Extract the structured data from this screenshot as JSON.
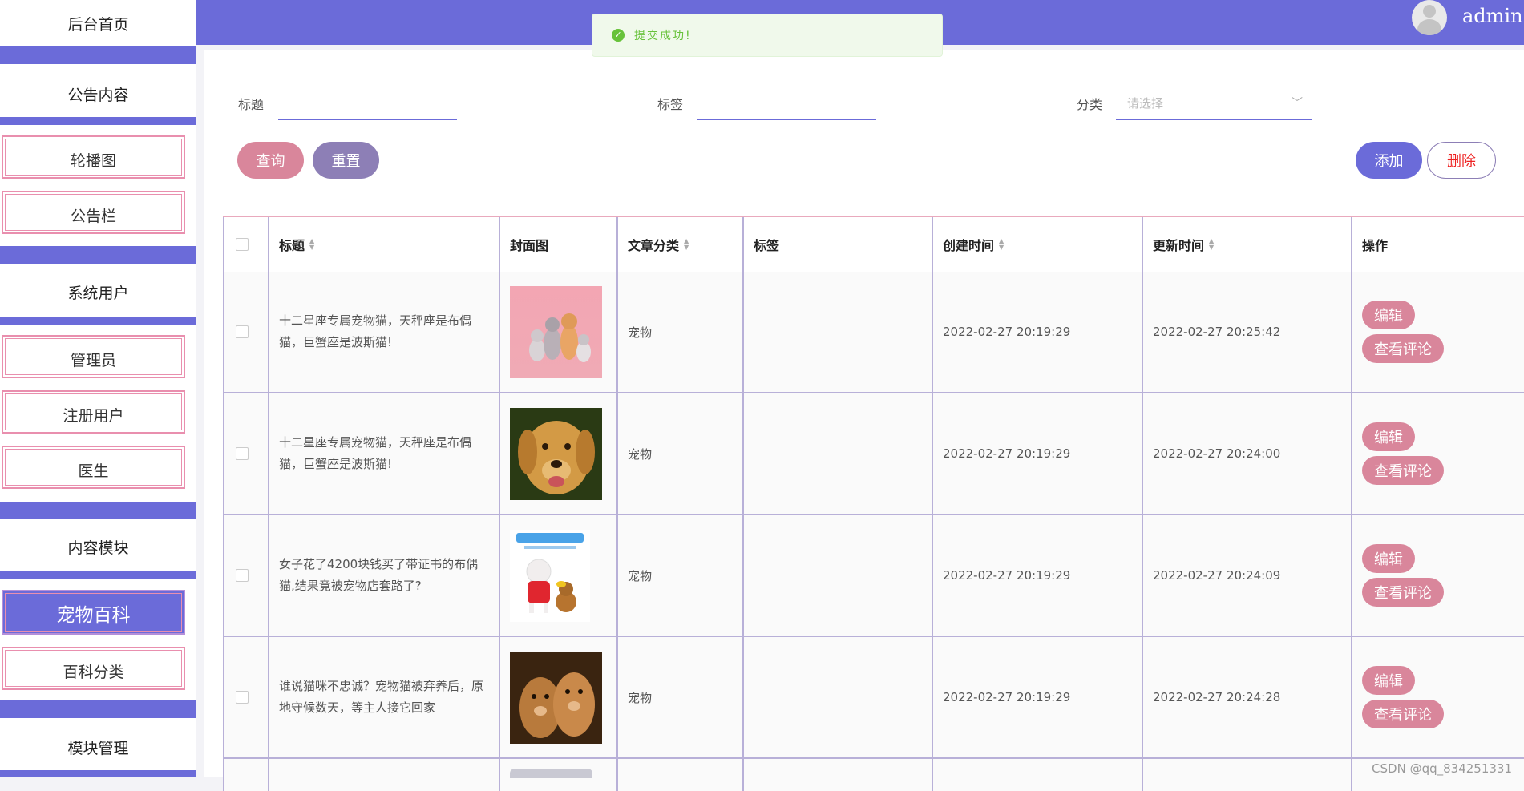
{
  "sidebar": {
    "home": "后台首页",
    "groups": {
      "notice": "公告内容",
      "system": "系统用户",
      "content": "内容模块",
      "module": "模块管理"
    },
    "items": {
      "carousel": "轮播图",
      "bulletin": "公告栏",
      "admin": "管理员",
      "users": "注册用户",
      "doctor": "医生",
      "pet_wiki": "宠物百科",
      "wiki_category": "百科分类"
    },
    "active_item": "宠物百科"
  },
  "header": {
    "username": "admin"
  },
  "toast": {
    "message": "提交成功!",
    "type": "success"
  },
  "filters": {
    "title_label": "标题",
    "tag_label": "标签",
    "category_label": "分类",
    "category_placeholder": "请选择"
  },
  "buttons": {
    "search": "查询",
    "reset": "重置",
    "add": "添加",
    "delete": "删除"
  },
  "table": {
    "columns": [
      "标题",
      "封面图",
      "文章分类",
      "标签",
      "创建时间",
      "更新时间",
      "操作"
    ],
    "rows": [
      {
        "title": "十二星座专属宠物猫，天秤座是布偶猫，巨蟹座是波斯猫!",
        "cover": "pink-cats-dog-photo",
        "category": "宠物",
        "tag": "",
        "created": "2022-02-27 20:19:29",
        "updated": "2022-02-27 20:25:42"
      },
      {
        "title": "十二星座专属宠物猫，天秤座是布偶猫，巨蟹座是波斯猫!",
        "cover": "golden-retriever-photo",
        "category": "宠物",
        "tag": "",
        "created": "2022-02-27 20:19:29",
        "updated": "2022-02-27 20:24:00"
      },
      {
        "title": "女子花了4200块钱买了带证书的布偶猫,结果竟被宠物店套路了?",
        "cover": "poodle-poster-photo",
        "category": "宠物",
        "tag": "",
        "created": "2022-02-27 20:19:29",
        "updated": "2022-02-27 20:24:09"
      },
      {
        "title": "谁说猫咪不忠诚？宠物猫被弃养后，原地守候数天，等主人接它回家",
        "cover": "two-puppies-photo",
        "category": "宠物",
        "tag": "",
        "created": "2022-02-27 20:19:29",
        "updated": "2022-02-27 20:24:28"
      }
    ],
    "row_actions": {
      "edit": "编辑",
      "comments": "查看评论"
    }
  },
  "watermark": "CSDN @qq_834251331",
  "colors": {
    "primary": "#6b6bd9",
    "pink": "#d9869b",
    "mauve": "#8d7fb6",
    "success": "#67c23a"
  }
}
